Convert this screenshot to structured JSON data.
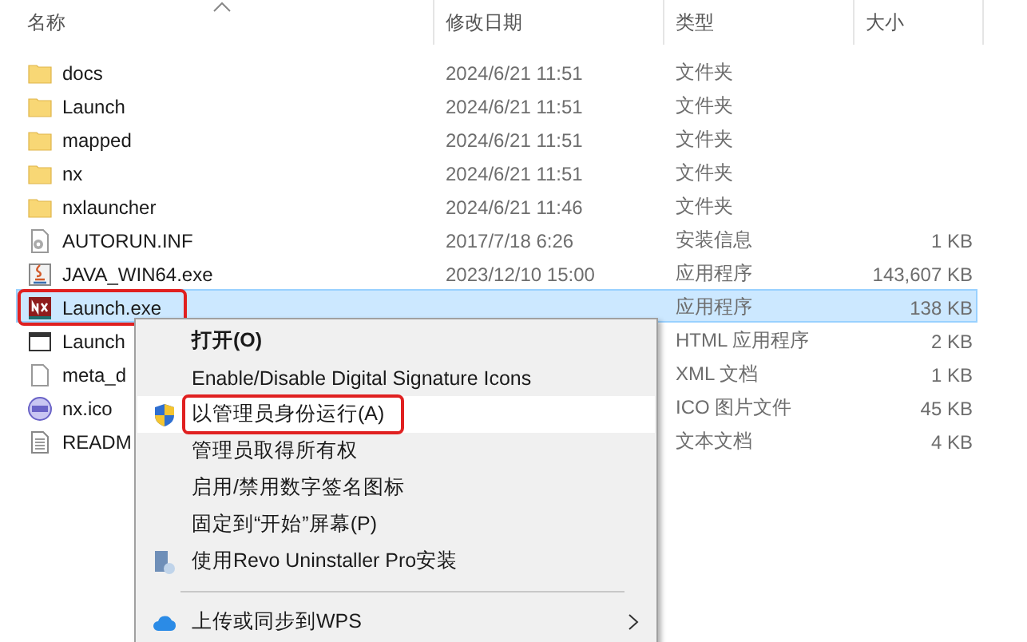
{
  "columns": [
    {
      "label": "名称",
      "sorted": true
    },
    {
      "label": "修改日期",
      "sorted": false
    },
    {
      "label": "类型",
      "sorted": false
    },
    {
      "label": "大小",
      "sorted": false
    }
  ],
  "files": [
    {
      "kind": "folder",
      "name": "docs",
      "date": "2024/6/21 11:51",
      "type": "文件夹",
      "selected": false,
      "annotated": false
    },
    {
      "kind": "folder",
      "name": "Launch",
      "date": "2024/6/21 11:51",
      "type": "文件夹",
      "selected": false,
      "annotated": false
    },
    {
      "kind": "folder",
      "name": "mapped",
      "date": "2024/6/21 11:51",
      "type": "文件夹",
      "selected": false,
      "annotated": false
    },
    {
      "kind": "folder",
      "name": "nx",
      "date": "2024/6/21 11:51",
      "type": "文件夹",
      "selected": false,
      "annotated": false
    },
    {
      "kind": "folder",
      "name": "nxlauncher",
      "date": "2024/6/21 11:46",
      "type": "文件夹",
      "selected": false,
      "annotated": false
    },
    {
      "kind": "settings",
      "name": "AUTORUN.INF",
      "date": "2017/7/18 6:26",
      "type": "安装信息",
      "size": "1 KB",
      "selected": false,
      "annotated": false
    },
    {
      "kind": "java",
      "name": "JAVA_WIN64.exe",
      "date": "2023/12/10 15:00",
      "type": "应用程序",
      "size": "143,607 KB",
      "selected": false,
      "annotated": false
    },
    {
      "kind": "nx",
      "name": "Launch.exe",
      "type": "应用程序",
      "size": "138 KB",
      "selected": true,
      "annotated": true
    },
    {
      "kind": "window",
      "name": "Launch",
      "type": "HTML 应用程序",
      "size": "2 KB",
      "selected": false,
      "annotated": false
    },
    {
      "kind": "blank",
      "name": "meta_d",
      "type": "XML 文档",
      "size": "1 KB",
      "selected": false,
      "annotated": false
    },
    {
      "kind": "ico",
      "name": "nx.ico",
      "type": "ICO 图片文件",
      "size": "45 KB",
      "selected": false,
      "annotated": false
    },
    {
      "kind": "text",
      "name": "READM",
      "type": "文本文档",
      "size": "4 KB",
      "selected": false,
      "annotated": false
    }
  ],
  "context_menu": [
    {
      "kind": "plain",
      "label": "打开(O)",
      "bold": true,
      "submenu": false,
      "selected": false,
      "annotated": false
    },
    {
      "kind": "plain",
      "label": "Enable/Disable Digital Signature Icons",
      "bold": false,
      "submenu": false,
      "selected": false,
      "annotated": false
    },
    {
      "kind": "shield",
      "label": "以管理员身份运行(A)",
      "bold": false,
      "submenu": false,
      "selected": true,
      "annotated": true
    },
    {
      "kind": "plain",
      "label": "管理员取得所有权",
      "bold": false,
      "submenu": false,
      "selected": false,
      "annotated": false
    },
    {
      "kind": "plain",
      "label": "启用/禁用数字签名图标",
      "bold": false,
      "submenu": false,
      "selected": false,
      "annotated": false
    },
    {
      "kind": "plain",
      "label": "固定到“开始”屏幕(P)",
      "bold": false,
      "submenu": false,
      "selected": false,
      "annotated": false
    },
    {
      "kind": "installer",
      "label": "使用Revo Uninstaller Pro安装",
      "bold": false,
      "submenu": false,
      "selected": false,
      "annotated": false
    },
    {
      "kind": "separator"
    },
    {
      "kind": "cloud",
      "label": "上传或同步到WPS",
      "bold": false,
      "submenu": true,
      "selected": false,
      "annotated": false
    }
  ]
}
